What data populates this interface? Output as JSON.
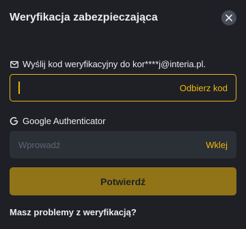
{
  "dialog": {
    "title": "Weryfikacja zabezpieczająca",
    "close_icon": "close-icon"
  },
  "email_section": {
    "icon": "envelope-icon",
    "label": "Wyślij kod weryfikacyjny do kor****j@interia.pl.",
    "input_value": "",
    "action_label": "Odbierz kod"
  },
  "ga_section": {
    "icon": "google-icon",
    "label": "Google Authenticator",
    "input_value": "",
    "placeholder": "Wprowadź",
    "action_label": "Wklej"
  },
  "confirm_button": {
    "label": "Potwierdź",
    "enabled": false
  },
  "help_link": {
    "label": "Masz problemy z weryfikacją?"
  },
  "colors": {
    "background": "#1e2026",
    "accent": "#f0b90b",
    "input_bg": "#2b2f36",
    "text": "#eaecef",
    "muted": "#5e6673"
  }
}
